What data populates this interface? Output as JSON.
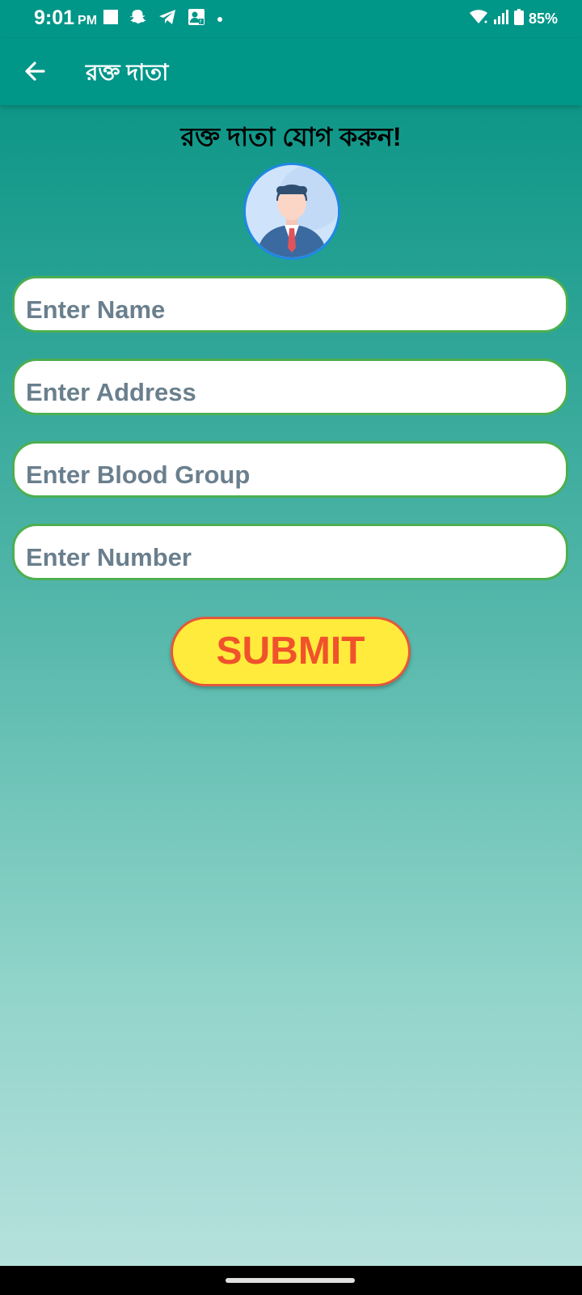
{
  "status_bar": {
    "time": "9:01",
    "ampm": "PM",
    "battery": "85%",
    "left_icons": [
      "stop-square-icon",
      "snapchat-icon",
      "telegram-icon",
      "contact-card-icon",
      "dot-icon"
    ],
    "right_icons": [
      "wifi-icon",
      "signal-icon",
      "battery-icon"
    ]
  },
  "app_bar": {
    "title": "রক্ত দাতা",
    "back_icon": "arrow-left-icon"
  },
  "form": {
    "heading": "রক্ত দাতা যোগ করুন!",
    "avatar_icon": "businessman-avatar-icon",
    "fields": {
      "name": {
        "placeholder": "Enter Name",
        "value": ""
      },
      "address": {
        "placeholder": "Enter Address",
        "value": ""
      },
      "blood_group": {
        "placeholder": "Enter Blood Group",
        "value": ""
      },
      "number": {
        "placeholder": "Enter Number",
        "value": ""
      }
    },
    "submit_label": "SUBMIT"
  },
  "colors": {
    "primary": "#009688",
    "field_border": "#4caf50",
    "submit_bg": "#ffeb3b",
    "submit_text": "#f0522c"
  }
}
